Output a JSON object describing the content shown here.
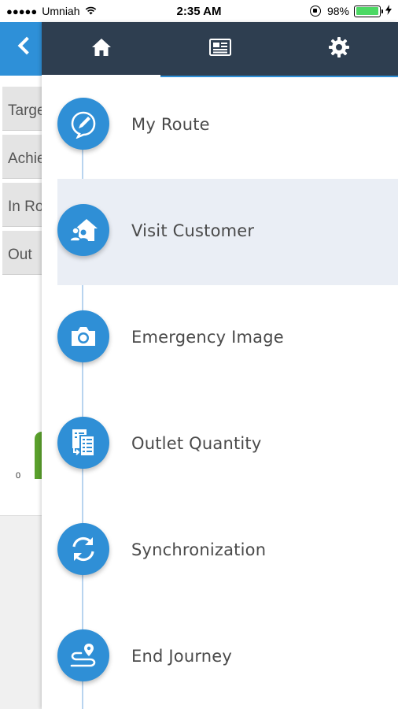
{
  "status_bar": {
    "signal": "●●●●●",
    "carrier": "Umniah",
    "time": "2:35 AM",
    "battery_percent": "98%",
    "battery_level": 0.98
  },
  "background_page": {
    "tabs": [
      "Target",
      "Achieved",
      "In Route",
      "Out"
    ],
    "chart_zero_label": "0"
  },
  "drawer": {
    "nav_tabs": [
      {
        "icon": "home-icon",
        "active": true
      },
      {
        "icon": "news-icon",
        "active": false
      },
      {
        "icon": "gear-icon",
        "active": false
      }
    ],
    "menu": [
      {
        "label": "My Route",
        "icon": "route-icon",
        "highlighted": false
      },
      {
        "label": "Visit Customer",
        "icon": "visit-customer-icon",
        "highlighted": true
      },
      {
        "label": "Emergency Image",
        "icon": "camera-icon",
        "highlighted": false
      },
      {
        "label": "Outlet Quantity",
        "icon": "outlet-quantity-icon",
        "highlighted": false
      },
      {
        "label": "Synchronization",
        "icon": "sync-icon",
        "highlighted": false
      },
      {
        "label": "End Journey",
        "icon": "end-journey-icon",
        "highlighted": false
      }
    ]
  },
  "colors": {
    "accent": "#2f8fd6",
    "header": "#2e3e50",
    "highlight": "#eaeef5"
  }
}
